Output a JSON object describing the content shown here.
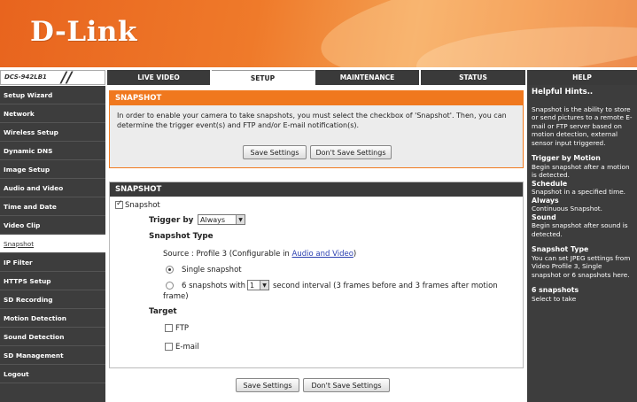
{
  "brand": {
    "logo": "D-Link",
    "model": "DCS-942LB1"
  },
  "topnav": {
    "tabs": [
      {
        "label": "LIVE VIDEO"
      },
      {
        "label": "SETUP"
      },
      {
        "label": "MAINTENANCE"
      },
      {
        "label": "STATUS"
      }
    ],
    "active": "SETUP"
  },
  "sidebar": {
    "items": [
      {
        "label": "Setup Wizard"
      },
      {
        "label": "Network"
      },
      {
        "label": "Wireless Setup"
      },
      {
        "label": "Dynamic DNS"
      },
      {
        "label": "Image Setup"
      },
      {
        "label": "Audio and Video"
      },
      {
        "label": "Time and Date"
      },
      {
        "label": "Video Clip"
      },
      {
        "label": "Snapshot"
      },
      {
        "label": "IP Filter"
      },
      {
        "label": "HTTPS Setup"
      },
      {
        "label": "SD Recording"
      },
      {
        "label": "Motion Detection"
      },
      {
        "label": "Sound Detection"
      },
      {
        "label": "SD Management"
      },
      {
        "label": "Logout"
      }
    ],
    "active": "Snapshot"
  },
  "intro": {
    "heading": "SNAPSHOT",
    "description": "In order to enable your camera to take snapshots, you must select the checkbox of 'Snapshot'. Then, you can determine the trigger event(s) and FTP and/or E-mail notification(s).",
    "save_label": "Save Settings",
    "dont_save_label": "Don't Save Settings"
  },
  "snapshot": {
    "heading": "SNAPSHOT",
    "enable_label": "Snapshot",
    "enable_checked": true,
    "trigger_label": "Trigger by",
    "trigger_value": "Always",
    "type_label": "Snapshot Type",
    "source_prefix": "Source : Profile 3 (Configurable in ",
    "source_link": "Audio and Video",
    "source_suffix": ")",
    "single_label": "Single snapshot",
    "multi_prefix": "6 snapshots with",
    "multi_interval": "1",
    "multi_suffix": "second interval (3 frames before and 3 frames after motion",
    "multi_suffix2": "frame)",
    "selected_type": "single",
    "target_label": "Target",
    "ftp_label": "FTP",
    "ftp_checked": false,
    "email_label": "E-mail",
    "email_checked": false
  },
  "footer": {
    "save_label": "Save Settings",
    "dont_save_label": "Don't Save Settings"
  },
  "help": {
    "tab_label": "HELP",
    "title": "Helpful Hints..",
    "intro": "Snapshot is the ability to store or send pictures to a remote E-mail or FTP server based on motion detection, external sensor input triggered.",
    "trigger_motion_head": "Trigger by Motion",
    "trigger_motion_text": "Begin snapshot after a motion is detected.",
    "schedule_head": "Schedule",
    "schedule_text": "Snapshot in a specified time.",
    "always_head": "Always",
    "always_text": "Continuous Snapshot.",
    "sound_head": "Sound",
    "sound_text": "Begin snapshot after sound is detected.",
    "type_head": "Snapshot Type",
    "type_text": "You can set JPEG settings from Video Profile 3, Single snapshot or 6 snapshots here.",
    "six_head": "6 snapshots",
    "six_text": "Select to take"
  },
  "colors": {
    "accent": "#f0781e",
    "dark": "#3d3d3d",
    "link": "#2a3fb0"
  }
}
